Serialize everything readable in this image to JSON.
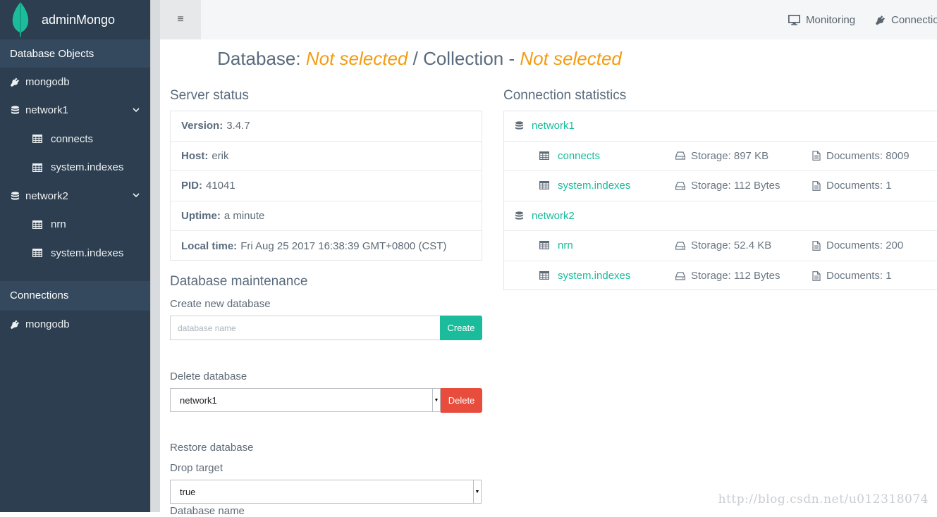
{
  "app": {
    "name": "adminMongo"
  },
  "sidebar": {
    "section_db": "Database Objects",
    "server": "mongodb",
    "databases": [
      {
        "name": "network1",
        "collections": [
          "connects",
          "system.indexes"
        ]
      },
      {
        "name": "network2",
        "collections": [
          "nrn",
          "system.indexes"
        ]
      }
    ],
    "section_conn": "Connections",
    "connection": "mongodb"
  },
  "topbar": {
    "monitoring": "Monitoring",
    "connections": "Connectio"
  },
  "title": {
    "db_label": "Database:",
    "db_value": "Not selected",
    "sep": "/ Collection -",
    "coll_value": "Not selected"
  },
  "server_status": {
    "heading": "Server status",
    "rows": [
      {
        "label": "Version:",
        "value": "3.4.7"
      },
      {
        "label": "Host:",
        "value": "erik"
      },
      {
        "label": "PID:",
        "value": "41041"
      },
      {
        "label": "Uptime:",
        "value": "a minute"
      },
      {
        "label": "Local time:",
        "value": "Fri Aug 25 2017 16:38:39 GMT+0800 (CST)"
      }
    ]
  },
  "maintenance": {
    "heading": "Database maintenance",
    "create_label": "Create new database",
    "create_placeholder": "database name",
    "create_button": "Create",
    "delete_label": "Delete database",
    "delete_selected": "network1",
    "delete_button": "Delete",
    "restore_label": "Restore database",
    "drop_label": "Drop target",
    "drop_selected": "true",
    "dbname_label": "Database name"
  },
  "connection_stats": {
    "heading": "Connection statistics",
    "databases": [
      {
        "name": "network1",
        "collections": [
          {
            "name": "connects",
            "storage": "Storage: 897 KB",
            "documents": "Documents: 8009"
          },
          {
            "name": "system.indexes",
            "storage": "Storage: 112 Bytes",
            "documents": "Documents: 1"
          }
        ]
      },
      {
        "name": "network2",
        "collections": [
          {
            "name": "nrn",
            "storage": "Storage: 52.4 KB",
            "documents": "Documents: 200"
          },
          {
            "name": "system.indexes",
            "storage": "Storage: 112 Bytes",
            "documents": "Documents: 1"
          }
        ]
      }
    ]
  },
  "watermark": "http://blog.csdn.net/u012318074",
  "colors": {
    "sidebar": "#2c3e50",
    "accent": "#18bc9c",
    "warning": "#f39c12",
    "danger": "#e74c3c"
  }
}
